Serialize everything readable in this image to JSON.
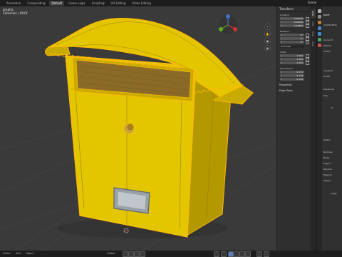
{
  "header": {
    "tabs": [
      "Animation",
      "Compositing",
      "Default",
      "Game Logic",
      "Scripting",
      "UV Editing",
      "Video Editing"
    ],
    "active_tab": "Default",
    "scene_label": "Scene"
  },
  "viewport": {
    "title_line1": "graphic",
    "title_line2": "Collection | ROOF"
  },
  "npanel": {
    "header": "Transform",
    "location_label": "Location:",
    "location": [
      {
        "axis": "X",
        "value": "0.00000"
      },
      {
        "axis": "Y",
        "value": "0.00000"
      },
      {
        "axis": "Z",
        "value": "0.34800"
      }
    ],
    "rotation_label": "Rotation:",
    "rotation": [
      {
        "axis": "X",
        "value": "0°"
      },
      {
        "axis": "Y",
        "value": "0°"
      },
      {
        "axis": "Z",
        "value": "0°"
      }
    ],
    "rotation_mode": "XYZ Euler",
    "scale_label": "Scale:",
    "scale": [
      {
        "axis": "X",
        "value": "1.000"
      },
      {
        "axis": "Y",
        "value": "1.000"
      },
      {
        "axis": "Z",
        "value": "1.000"
      }
    ],
    "dimensions_label": "Dimensions:",
    "dimensions": [
      {
        "axis": "X",
        "value": "0.370"
      },
      {
        "axis": "Y",
        "value": "0.278"
      },
      {
        "axis": "Z",
        "value": "0.128"
      }
    ],
    "sections": [
      "Properties",
      "Edge Tools"
    ]
  },
  "vtabs": [
    "Item",
    "Tool",
    "View",
    "Edit"
  ],
  "properties": {
    "object_name": "ROOF",
    "add_modifier": "Add Modifier",
    "labels": [
      "Curve Dr",
      "Deform",
      "Vertex",
      "Levels Vi",
      "Sculpt",
      "Advanced",
      "Sub",
      "Tr",
      "Vertex",
      "Normals",
      "Noise",
      "Edge C",
      "Recover",
      "Edge Cr",
      "Output",
      "Edge"
    ]
  },
  "status": {
    "select_label": "Select",
    "box_label": "Box Select",
    "add_label": "Add",
    "object_label": "Object",
    "global_label": "Global"
  },
  "colors": {
    "model": "#e4c600",
    "model_dark": "#b39800",
    "outline": "#ffb800",
    "background": "#3a3a3a"
  }
}
